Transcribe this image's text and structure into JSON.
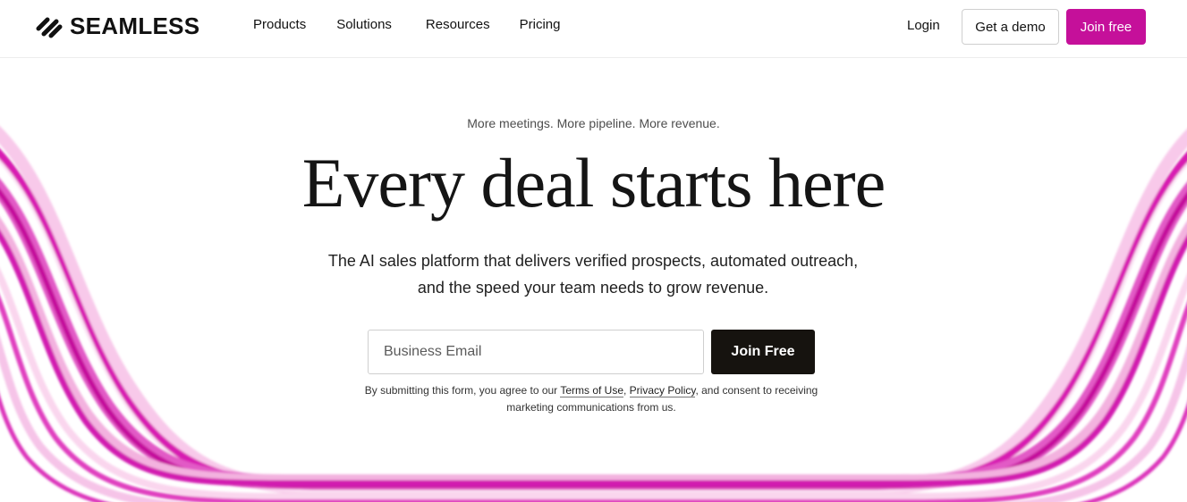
{
  "brand": {
    "name": "SEAMLESS",
    "logo_icon": "seamless-swoosh-icon",
    "accent": "#c5109a"
  },
  "nav": {
    "items": [
      {
        "label": "Products"
      },
      {
        "label": "Solutions"
      },
      {
        "label": "Resources"
      },
      {
        "label": "Pricing"
      }
    ]
  },
  "header_actions": {
    "login": "Login",
    "demo": "Get a demo",
    "join": "Join free"
  },
  "hero": {
    "eyebrow": "More meetings. More pipeline. More revenue.",
    "headline": "Every deal starts here",
    "subhead": "The AI sales platform that delivers verified prospects, automated outreach, and the speed your team needs to grow revenue."
  },
  "form": {
    "email_placeholder": "Business Email",
    "submit": "Join Free",
    "disclaimer_prefix": "By submitting this form, you agree to our ",
    "terms_link": "Terms of Use",
    "comma": ", ",
    "privacy_link": "Privacy Policy",
    "disclaimer_suffix": ", and consent to receiving marketing communications from us."
  },
  "decor": {
    "wave_color": "#d21ab0",
    "wave_light": "#f6bfe6"
  }
}
